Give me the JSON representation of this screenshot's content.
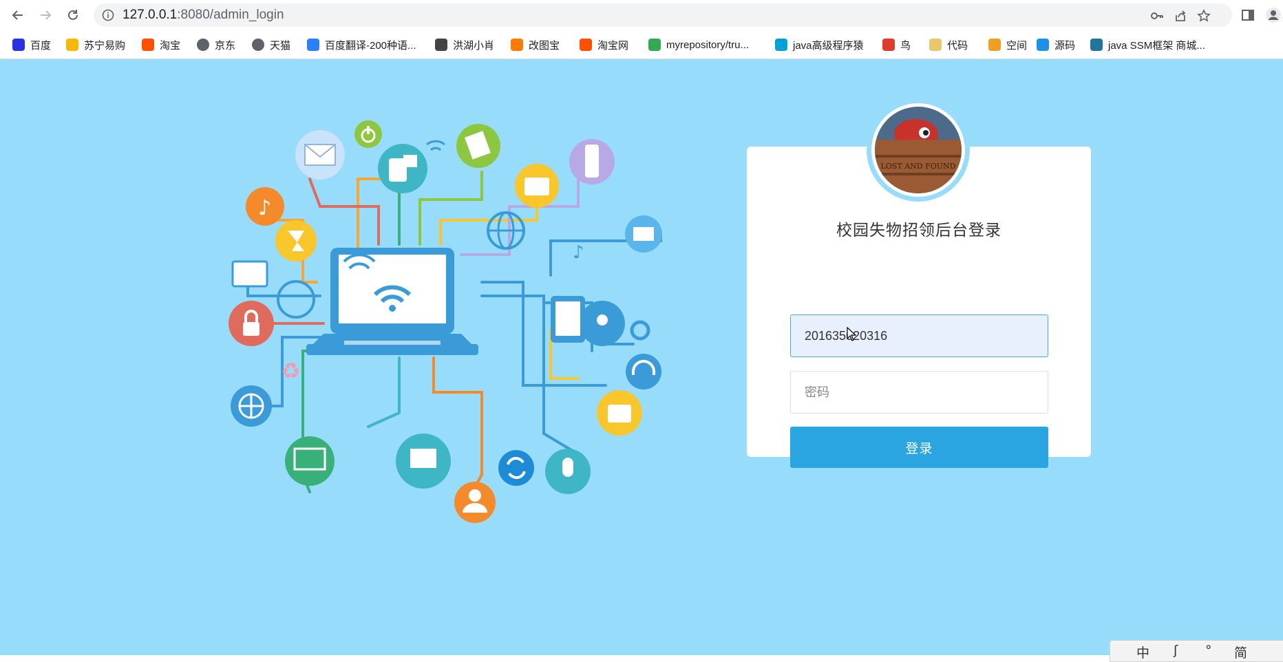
{
  "browser": {
    "url_host": "127.0.0.1",
    "url_path": ":8080/admin_login",
    "bookmarks": [
      {
        "label": "百度",
        "icon": "baidu-icon",
        "color": "#2932e1"
      },
      {
        "label": "苏宁易购",
        "icon": "suning-icon",
        "color": "#f5b90a"
      },
      {
        "label": "淘宝",
        "icon": "taobao-icon",
        "color": "#ff5000"
      },
      {
        "label": "京东",
        "icon": "globe-icon",
        "color": "#5f6368"
      },
      {
        "label": "天猫",
        "icon": "globe-icon",
        "color": "#5f6368"
      },
      {
        "label": "百度翻译-200种语...",
        "icon": "baidu-translate-icon",
        "color": "#2d7ff9"
      },
      {
        "label": "洪湖小肖",
        "icon": "pen-icon",
        "color": "#444444"
      },
      {
        "label": "改图宝",
        "icon": "gaitubao-icon",
        "color": "#ff7a00"
      },
      {
        "label": "淘宝网",
        "icon": "taobao-icon",
        "color": "#ff5000"
      },
      {
        "label": "myrepository/tru...",
        "icon": "chrome-icon",
        "color": "#34a853"
      },
      {
        "label": "java高级程序猿",
        "icon": "bilibili-icon",
        "color": "#00a1d6"
      },
      {
        "label": "鸟",
        "icon": "bird-icon",
        "color": "#e03b2b"
      },
      {
        "label": "代码",
        "icon": "moon-icon",
        "color": "#e8c86a"
      },
      {
        "label": "空间",
        "icon": "qzone-icon",
        "color": "#f0a020"
      },
      {
        "label": "源码",
        "icon": "docker-icon",
        "color": "#1d91e6"
      },
      {
        "label": "java SSM框架 商城...",
        "icon": "wordpress-icon",
        "color": "#21759b"
      }
    ]
  },
  "login": {
    "title": "校园失物招领后台登录",
    "username_value": "201635020316",
    "password_placeholder": "密码",
    "submit_label": "登录",
    "avatar_text": "LOST AND FOUND"
  },
  "ime": {
    "items": [
      "中",
      "ʃ",
      "°",
      "简"
    ]
  },
  "colors": {
    "page_background": "#97dcfb",
    "button": "#2aa5e1"
  }
}
